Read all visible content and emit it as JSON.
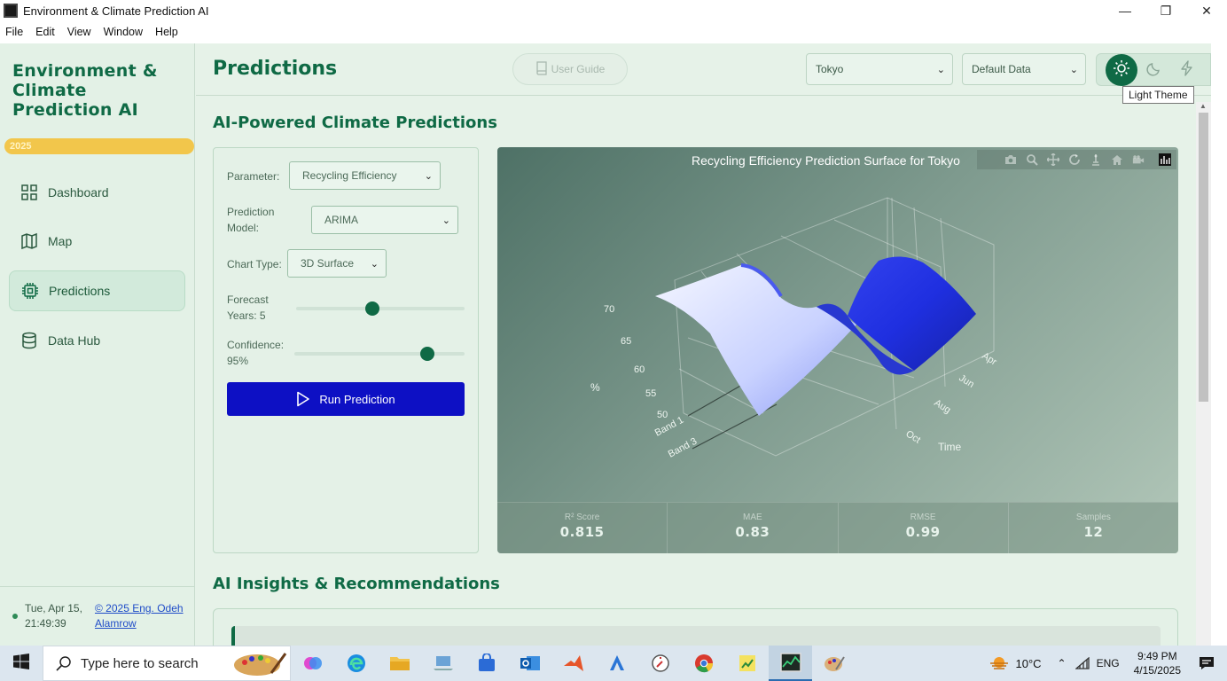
{
  "window": {
    "title": "Environment & Climate Prediction AI"
  },
  "menu": [
    "File",
    "Edit",
    "View",
    "Window",
    "Help"
  ],
  "sidebar": {
    "brand": "Environment & Climate Prediction AI",
    "year": "2025",
    "items": [
      {
        "label": "Dashboard",
        "icon": "grid-icon",
        "active": false
      },
      {
        "label": "Map",
        "icon": "map-icon",
        "active": false
      },
      {
        "label": "Predictions",
        "icon": "chip-icon",
        "active": true
      },
      {
        "label": "Data Hub",
        "icon": "database-icon",
        "active": false
      }
    ],
    "footer": {
      "date": "Tue, Apr 15,",
      "time": "21:49:39",
      "credit": "© 2025 Eng. Odeh Alamrow"
    }
  },
  "header": {
    "title": "Predictions",
    "user_guide": "User Guide",
    "city": "Tokyo",
    "dataset": "Default Data",
    "tooltip": "Light Theme"
  },
  "main": {
    "section_title": "AI-Powered Climate Predictions",
    "controls": {
      "parameter_label": "Parameter:",
      "parameter_value": "Recycling Efficiency",
      "model_label": "Prediction Model:",
      "model_value": "ARIMA",
      "chart_type_label": "Chart Type:",
      "chart_type_value": "3D Surface",
      "forecast_label": "Forecast Years: 5",
      "forecast_fraction": 0.45,
      "confidence_label": "Confidence: 95%",
      "confidence_fraction": 0.78,
      "run_button": "Run Prediction"
    },
    "chart": {
      "title": "Recycling Efficiency Prediction Surface for Tokyo",
      "z_axis_title": "%",
      "z_ticks": [
        "70",
        "65",
        "60",
        "55",
        "50"
      ],
      "y_ticks": [
        "Band 1",
        "Band 3"
      ],
      "x_ticks": [
        "Apr",
        "Jun",
        "Aug",
        "Oct"
      ],
      "x_axis_title": "Time",
      "modebar": [
        "camera-icon",
        "zoom-icon",
        "pan-icon",
        "orbit-icon",
        "turntable-icon",
        "home-icon",
        "video-icon",
        "plotly-logo-icon"
      ]
    },
    "metrics": [
      {
        "label": "R² Score",
        "value": "0.815"
      },
      {
        "label": "MAE",
        "value": "0.83"
      },
      {
        "label": "RMSE",
        "value": "0.99"
      },
      {
        "label": "Samples",
        "value": "12"
      }
    ],
    "insights_title": "AI Insights & Recommendations"
  },
  "taskbar": {
    "search_placeholder": "Type here to search",
    "weather": "10°C",
    "language": "ENG",
    "time": "9:49 PM",
    "date": "4/15/2025"
  },
  "colors": {
    "brand_green": "#0f6a45",
    "run_blue": "#0d10c4",
    "year_yellow": "#f2c64b",
    "surface_blue": "#1f2fe0"
  }
}
